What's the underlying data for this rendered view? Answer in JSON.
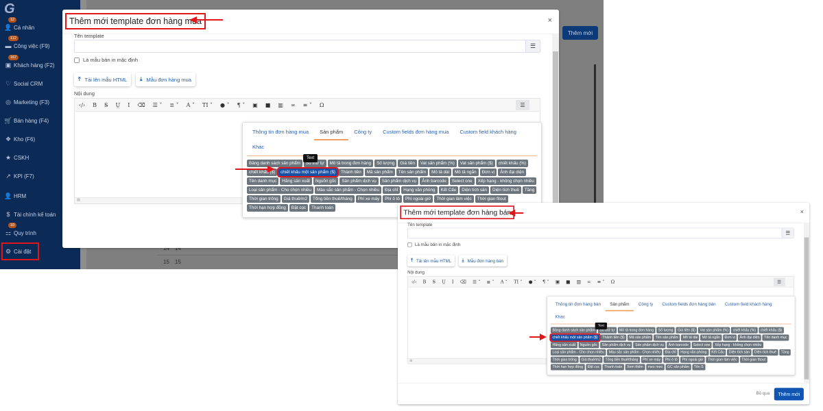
{
  "background": {
    "logo": "G",
    "sidebar": [
      {
        "label": "Cá nhân",
        "icon": "user-icon",
        "glyph": "👤",
        "badge": "12"
      },
      {
        "label": "Công việc (F9)",
        "icon": "briefcase-icon",
        "glyph": "▬",
        "badge": "112"
      },
      {
        "label": "Khách hàng (F2)",
        "icon": "customers-icon",
        "glyph": "▣",
        "badge": "167"
      },
      {
        "label": "Social CRM",
        "icon": "handshake-icon",
        "glyph": "♡"
      },
      {
        "label": "Marketing (F3)",
        "icon": "target-icon",
        "glyph": "◎"
      },
      {
        "label": "Bán hàng (F4)",
        "icon": "cart-icon",
        "glyph": "🛒"
      },
      {
        "label": "Kho (F6)",
        "icon": "boxes-icon",
        "glyph": "❖"
      },
      {
        "label": "CSKH",
        "icon": "star-icon",
        "glyph": "★"
      },
      {
        "label": "KPI (F7)",
        "icon": "chart-line-icon",
        "glyph": "↗"
      },
      {
        "label": "HRM",
        "icon": "person-icon",
        "glyph": "👤"
      },
      {
        "label": "Tài chính kế toán",
        "icon": "dollar-icon",
        "glyph": "$"
      },
      {
        "label": "Quy trình",
        "icon": "sitemap-icon",
        "glyph": "⚏",
        "badge": "10"
      },
      {
        "label": "Cài đặt",
        "icon": "gear-icon",
        "glyph": "⚙"
      }
    ],
    "add_button": "Thêm mới",
    "rows": [
      [
        "14",
        "14"
      ],
      [
        "15",
        "15"
      ]
    ]
  },
  "modals": [
    {
      "title": "Thêm mới template đơn hàng mua",
      "name_label": "Tên template",
      "default_label": "Là mẫu bản in mặc định",
      "upload_label": "Tải lên mẫu HTML",
      "sample_label": "Mẫu đơn hàng mua",
      "content_label": "Nội dung",
      "tabs": [
        "Thông tin đơn hàng mua",
        "Sản phẩm",
        "Công ty",
        "Custom fields đơn hàng mua",
        "Custom field khách hàng",
        "Khác"
      ],
      "active_tab": 1,
      "tooltip": "Text",
      "highlight": 9,
      "tags": [
        "Bảng danh sách sản phẩm",
        "Số thứ tự",
        "Mô tả trong đơn hàng",
        "Số lượng",
        "Giá tiền",
        "Vat sản phẩm (%)",
        "Vat sản phẩm ($)",
        "chiết khấu (%)",
        "chiết khấu ($)",
        "chiết khấu một sản phẩm ($)",
        "Thành tiền",
        "Mã sản phẩm",
        "Tên sản phẩm",
        "Mô tả dài",
        "Mô tả ngắn",
        "Đơn vị",
        "Ảnh đại diện",
        "Tên danh mục",
        "Hãng sản xuất",
        "Nguồn gốc",
        "Sản phẩm dịch vụ",
        "Sản phẩm dịch vụ",
        "Ảnh barcode",
        "Select one",
        "Xếp hạng - không chọn nhiều",
        "Loại sản phẩm - Cho chọn nhiều",
        "Màu sắc sản phẩm - Chọn nhiều",
        "Địa chỉ",
        "Hạng văn phòng",
        "Kết Cấu",
        "Diện tích sàn",
        "Diện tích thuê",
        "Tầng",
        "Thời gian trống",
        "Giá thuê/m2",
        "Tổng tiền thuê/tháng",
        "Phí xe máy",
        "Phí ô tô",
        "Phí ngoài giờ",
        "Thời gian làm việc",
        "Thời gian fitout",
        "Thời hạn hợp đồng",
        "Đặt cọc",
        "Thanh toán"
      ]
    },
    {
      "title": "Thêm mới template đơn hàng bán",
      "name_label": "Tên template",
      "default_label": "Là mẫu bản in mặc định",
      "upload_label": "Tải lên mẫu HTML",
      "sample_label": "Mẫu đơn hàng bán",
      "content_label": "Nội dung",
      "tabs": [
        "Thông tin đơn hàng bán",
        "Sản phẩm",
        "Công ty",
        "Custom fields đơn hàng bán",
        "Custom field khách hàng",
        "Khác"
      ],
      "active_tab": 1,
      "tooltip": "Text",
      "highlight": 8,
      "tags": [
        "Bảng danh sách sản phẩm",
        "Số thứ tự",
        "Mô tả trong đơn hàng",
        "Số lượng",
        "Giá tiền ($)",
        "Vat sản phẩm (%)",
        "chiết khấu (%)",
        "chiết khấu ($)",
        "chiết khấu một sản phẩm ($)",
        "Thành tiền ($)",
        "Mã sản phẩm",
        "Tên sản phẩm",
        "Mô tả dài",
        "Mô tả ngắn",
        "Đơn vị",
        "Ảnh đại diện",
        "Tên danh mục",
        "Hãng sản xuất",
        "Nguồn gốc",
        "Sản phẩm dịch vụ",
        "Sản phẩm dịch vụ",
        "Ảnh barcode",
        "Select one",
        "Xếp hạng - không chọn nhiều",
        "Loại sản phẩm - Cho chọn nhiều",
        "Màu sắc sản phẩm - Chọn nhiều",
        "Địa chỉ",
        "Hạng văn phòng",
        "Kết Cấu",
        "Diện tích sàn",
        "Diện tích thuê",
        "Tầng",
        "Thời gian trống",
        "Giá thuê/m2",
        "Tổng tiền thuê/tháng",
        "Phí xe máy",
        "Phí ô tô",
        "Phí ngoài giờ",
        "Thời gian làm việc",
        "Thời gian fitout",
        "Thời hạn hợp đồng",
        "Đặt cọc",
        "Thanh toán",
        "Xem thêm",
        "meo meo",
        "GC sản phẩm",
        "Tên S"
      ],
      "footer": {
        "cancel": "Bỏ qua",
        "submit": "Thêm mới"
      }
    }
  ],
  "toolbar": [
    {
      "icon": "code-view-icon",
      "glyph": "‹/›"
    },
    {
      "icon": "bold-icon",
      "glyph": "B"
    },
    {
      "icon": "strikethrough-icon",
      "glyph": "S̶"
    },
    {
      "icon": "underline-icon",
      "glyph": "U̲"
    },
    {
      "icon": "italic-icon",
      "glyph": "I"
    },
    {
      "icon": "eraser-icon",
      "glyph": "⌫"
    },
    {
      "icon": "bullet-list-icon",
      "glyph": "☰ ˅"
    },
    {
      "icon": "ordered-list-icon",
      "glyph": "≣ ˅"
    },
    {
      "icon": "font-color-icon",
      "glyph": "A ˅"
    },
    {
      "icon": "font-size-icon",
      "glyph": "TI ˅"
    },
    {
      "icon": "droplet-icon",
      "glyph": "● ˅"
    },
    {
      "icon": "paragraph-icon",
      "glyph": "¶ ˅"
    },
    {
      "icon": "image-icon",
      "glyph": "▣"
    },
    {
      "icon": "video-icon",
      "glyph": "■"
    },
    {
      "icon": "table-icon",
      "glyph": "▥"
    },
    {
      "icon": "link-icon",
      "glyph": "∞"
    },
    {
      "icon": "align-icon",
      "glyph": "≡ ˅"
    },
    {
      "icon": "special-char-icon",
      "glyph": "Ω"
    }
  ],
  "colors": {
    "sidebar": "#0b2a56",
    "primary": "#1155b3",
    "tag": "#6c757d",
    "highlight": "#1750a5",
    "annotation": "#e0161b"
  }
}
